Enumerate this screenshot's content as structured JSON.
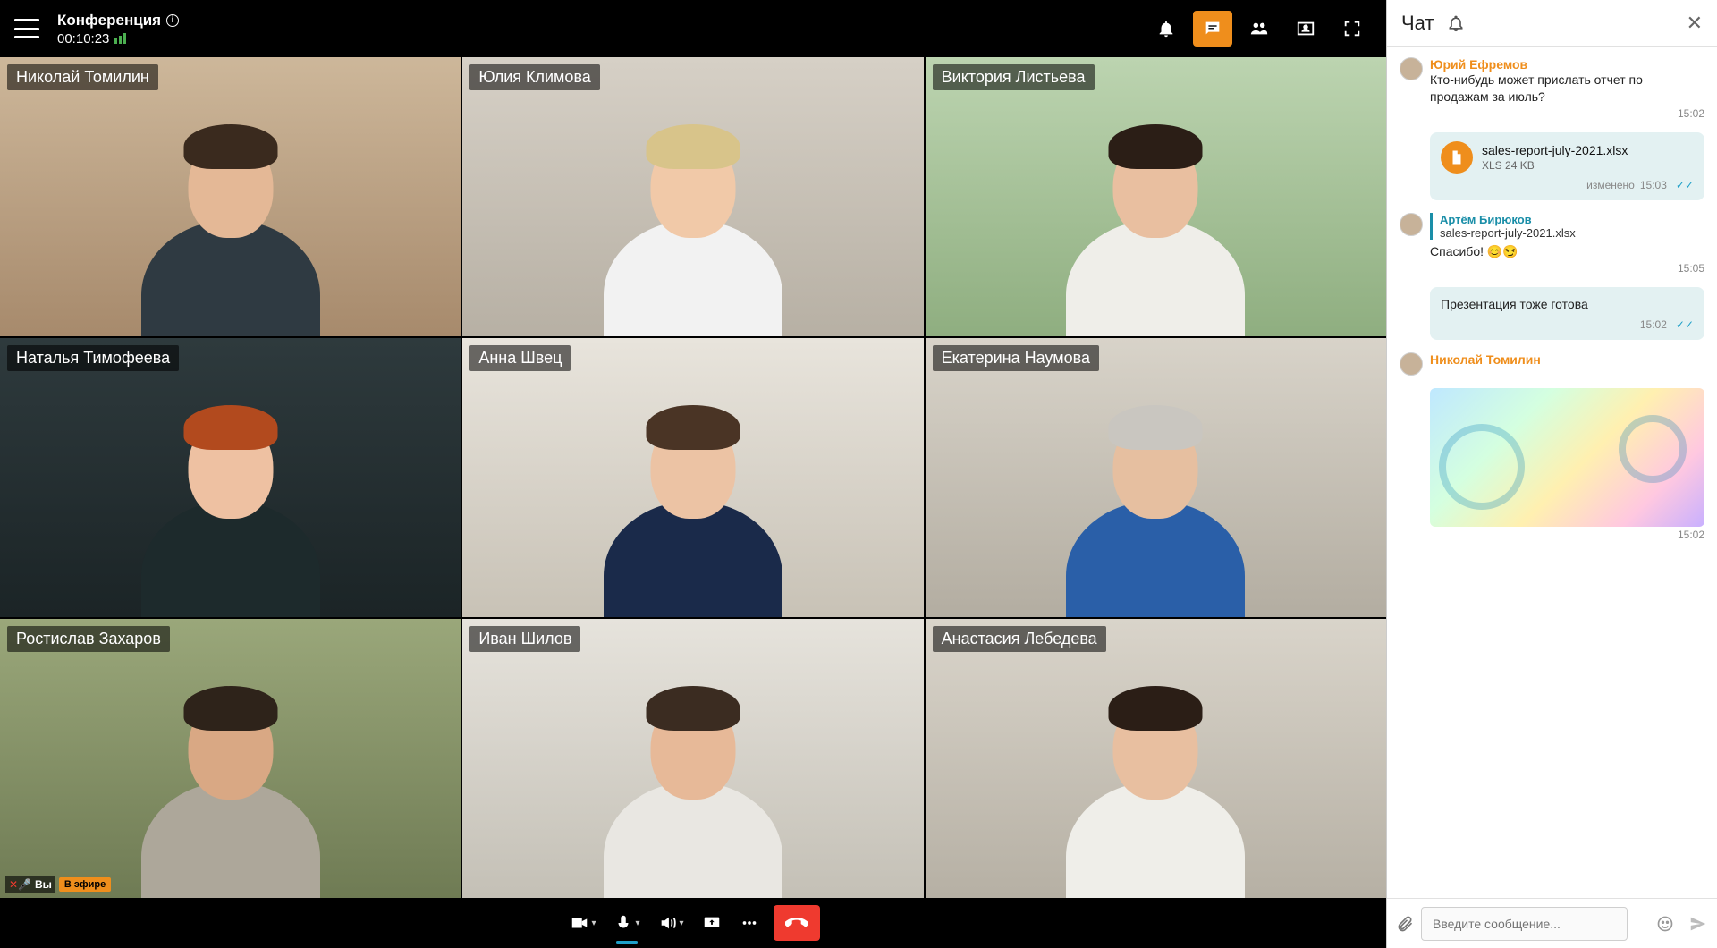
{
  "header": {
    "title": "Конференция",
    "timer": "00:10:23"
  },
  "participants": [
    {
      "name": "Николай Томилин",
      "bg": "linear-gradient(#cdb79a,#a78a6c)",
      "skin": "#e4b896",
      "hair": "#3a2a1e",
      "shirt": "#2f3a42"
    },
    {
      "name": "Юлия Климова",
      "bg": "linear-gradient(#d6d0c6,#b7b0a4)",
      "skin": "#f1c9a8",
      "hair": "#d8c48a",
      "shirt": "#f2f2f2"
    },
    {
      "name": "Виктория Листьева",
      "bg": "linear-gradient(#bcd4b0,#8fae80)",
      "skin": "#e9bfa0",
      "hair": "#2b1e16",
      "shirt": "#efeee9"
    },
    {
      "name": "Наталья Тимофеева",
      "bg": "linear-gradient(#2e3a3d,#1b2426)",
      "skin": "#eec1a2",
      "hair": "#b24a1e",
      "shirt": "#1d2a2c"
    },
    {
      "name": "Анна Швец",
      "bg": "linear-gradient(#e8e4dc,#c8c2b6)",
      "skin": "#ecc3a4",
      "hair": "#4a3425",
      "shirt": "#1a2a4a"
    },
    {
      "name": "Екатерина Наумова",
      "bg": "linear-gradient(#d8d3c9,#b3ada1)",
      "skin": "#e6bfa0",
      "hair": "#c9c6c0",
      "shirt": "#2a5fa8"
    },
    {
      "name": "Ростислав Захаров",
      "bg": "linear-gradient(#9aa77a,#6f7b54)",
      "skin": "#d9a884",
      "hair": "#2e231a",
      "shirt": "#ada79a",
      "self": true
    },
    {
      "name": "Иван Шилов",
      "bg": "linear-gradient(#e6e3dc,#c4c0b6)",
      "skin": "#e7b998",
      "hair": "#3b2c21",
      "shirt": "#e9e7e2"
    },
    {
      "name": "Анастасия Лебедева",
      "bg": "linear-gradient(#d9d4ca,#b6b0a4)",
      "skin": "#e8bfa0",
      "hair": "#2b1e16",
      "shirt": "#efeee9"
    }
  ],
  "self_badges": {
    "you": "Вы",
    "live": "В эфире"
  },
  "chat": {
    "title": "Чат",
    "messages": [
      {
        "type": "text",
        "sender": "Юрий Ефремов",
        "sender_style": "orange",
        "text": "Кто-нибудь может прислать отчет по продажам за июль?",
        "time": "15:02"
      },
      {
        "type": "file",
        "file_name": "sales-report-july-2021.xlsx",
        "file_meta": "XLS 24 KB",
        "edited": "изменено",
        "time": "15:03",
        "checks": true
      },
      {
        "type": "reply",
        "sender": "Артём Бирюков",
        "sender_style": "teal",
        "quoted_file": "sales-report-july-2021.xlsx",
        "text": "Спасибо! 😊😏",
        "time": "15:05"
      },
      {
        "type": "bubble_text",
        "text": "Презентация тоже готова",
        "time": "15:02",
        "checks": true
      },
      {
        "type": "image",
        "sender": "Николай Томилин",
        "sender_style": "orange",
        "time": "15:02"
      }
    ],
    "input_placeholder": "Введите сообщение..."
  }
}
